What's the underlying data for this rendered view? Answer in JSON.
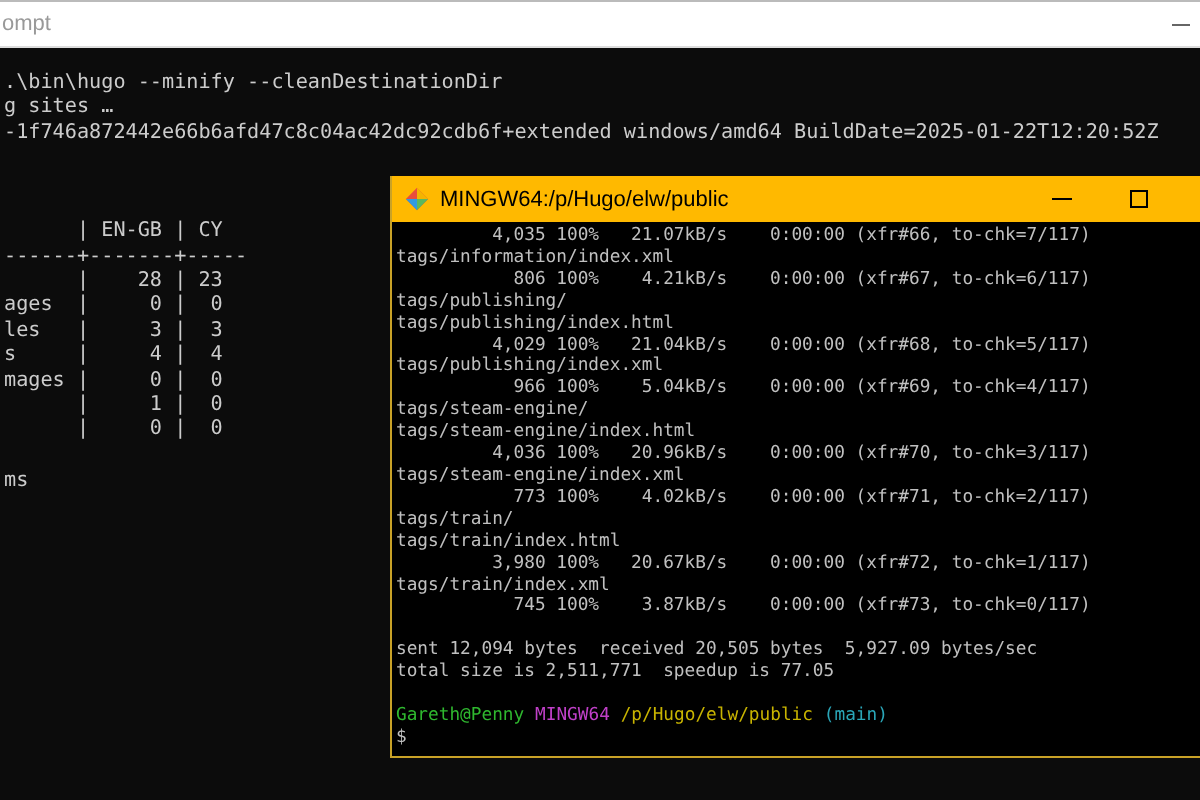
{
  "back_window": {
    "title": "ompt",
    "command_output": [
      ".\\bin\\hugo --minify --cleanDestinationDir",
      "g sites …",
      "-1f746a872442e66b6afd47c8c04ac42dc92cdb6f+extended windows/amd64 BuildDate=2025-01-22T12:20:52Z"
    ],
    "table": [
      "      | EN-GB | CY",
      "------+-------+-----",
      "      |    28 | 23",
      "ages  |     0 |  0",
      "les   |     3 |  3",
      "s     |     4 |  4",
      "mages |     0 |  0",
      "      |     1 |  0",
      "      |     0 |  0"
    ],
    "footer": [
      "ms"
    ]
  },
  "front_window": {
    "title": "MINGW64:/p/Hugo/elw/public",
    "transfer_log": [
      "         4,035 100%   21.07kB/s    0:00:00 (xfr#66, to-chk=7/117)",
      "tags/information/index.xml",
      "           806 100%    4.21kB/s    0:00:00 (xfr#67, to-chk=6/117)",
      "tags/publishing/",
      "tags/publishing/index.html",
      "         4,029 100%   21.04kB/s    0:00:00 (xfr#68, to-chk=5/117)",
      "tags/publishing/index.xml",
      "           966 100%    5.04kB/s    0:00:00 (xfr#69, to-chk=4/117)",
      "tags/steam-engine/",
      "tags/steam-engine/index.html",
      "         4,036 100%   20.96kB/s    0:00:00 (xfr#70, to-chk=3/117)",
      "tags/steam-engine/index.xml",
      "           773 100%    4.02kB/s    0:00:00 (xfr#71, to-chk=2/117)",
      "tags/train/",
      "tags/train/index.html",
      "         3,980 100%   20.67kB/s    0:00:00 (xfr#72, to-chk=1/117)",
      "tags/train/index.xml",
      "           745 100%    3.87kB/s    0:00:00 (xfr#73, to-chk=0/117)"
    ],
    "summary": [
      "sent 12,094 bytes  received 20,505 bytes  5,927.09 bytes/sec",
      "total size is 2,511,771  speedup is 77.05"
    ],
    "prompt": [
      {
        "kind": "user",
        "text": "Gareth@Penny"
      },
      {
        "kind": "shell",
        "text": "MINGW64"
      },
      {
        "kind": "path",
        "text": "/p/Hugo/elw/public"
      },
      {
        "kind": "branch",
        "text": "(main)"
      }
    ],
    "input_line": "$"
  }
}
